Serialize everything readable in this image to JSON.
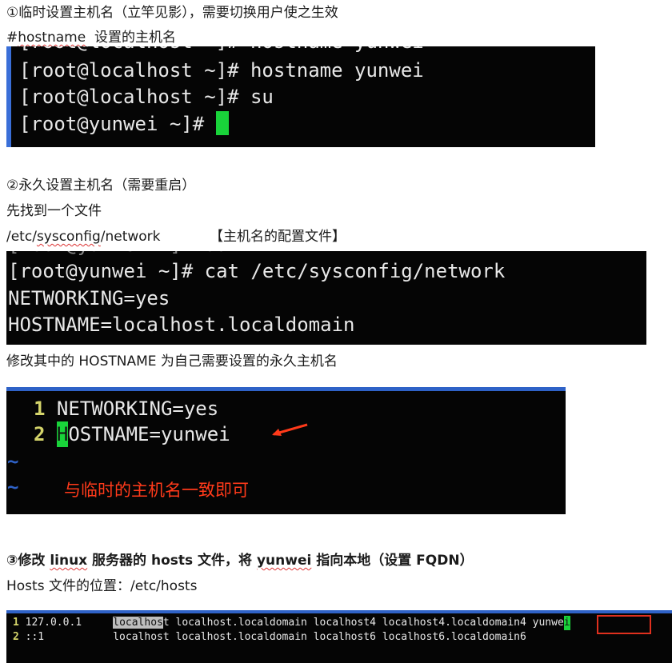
{
  "section1": {
    "title": "①临时设置主机名（立竿见影），需要切换用户使之生效",
    "cmd_line_hash": "#",
    "cmd_line_word": "hostname",
    "cmd_line_desc": "设置的主机名",
    "terminal": {
      "partial_top": "[root@localhost ~]# hostname yunwei",
      "line1": "[root@localhost ~]# hostname yunwei",
      "line2": "[root@localhost ~]# su",
      "line3": "[root@yunwei ~]# "
    }
  },
  "section2": {
    "title": "②永久设置主机名（需要重启）",
    "line1": "先找到一个文件",
    "path_prefix": "/etc/",
    "path_word": "sysconfig",
    "path_suffix": "/network",
    "path_note": "【主机名的配置文件】",
    "terminal": {
      "line1": "[root@yunwei ~]# cat /etc/sysconfig/network",
      "line2": "NETWORKING=yes",
      "line3": "HOSTNAME=localhost.localdomain"
    },
    "after": "修改其中的 HOSTNAME 为自己需要设置的永久主机名",
    "vi": {
      "n1": "1",
      "l1": "NETWORKING=yes",
      "n2": "2",
      "l2_cursor": "H",
      "l2_rest": "OSTNAME=yunwei",
      "tilde": "~",
      "note": "与临时的主机名一致即可"
    },
    "arrow_color": "#ff3a1a"
  },
  "section3": {
    "title_a": "③修改 ",
    "title_linux": "linux",
    "title_b": " 服务器的 hosts 文件，将 ",
    "title_yunwei": "yunwei",
    "title_c": " 指向本地（设置 FQDN）",
    "location": "Hosts 文件的位置：/etc/hosts",
    "hosts": {
      "n1": "1",
      "ip1": "127.0.0.1",
      "hl": "localhos",
      "r1": "t localhost.localdomain localhost4 localhost4.localdomain4",
      "y1": "yunwe",
      "y1c": "i",
      "n2": "2",
      "ip2": "::1",
      "r2": "localhost localhost.localdomain localhost6 localhost6.localdomain6"
    }
  }
}
